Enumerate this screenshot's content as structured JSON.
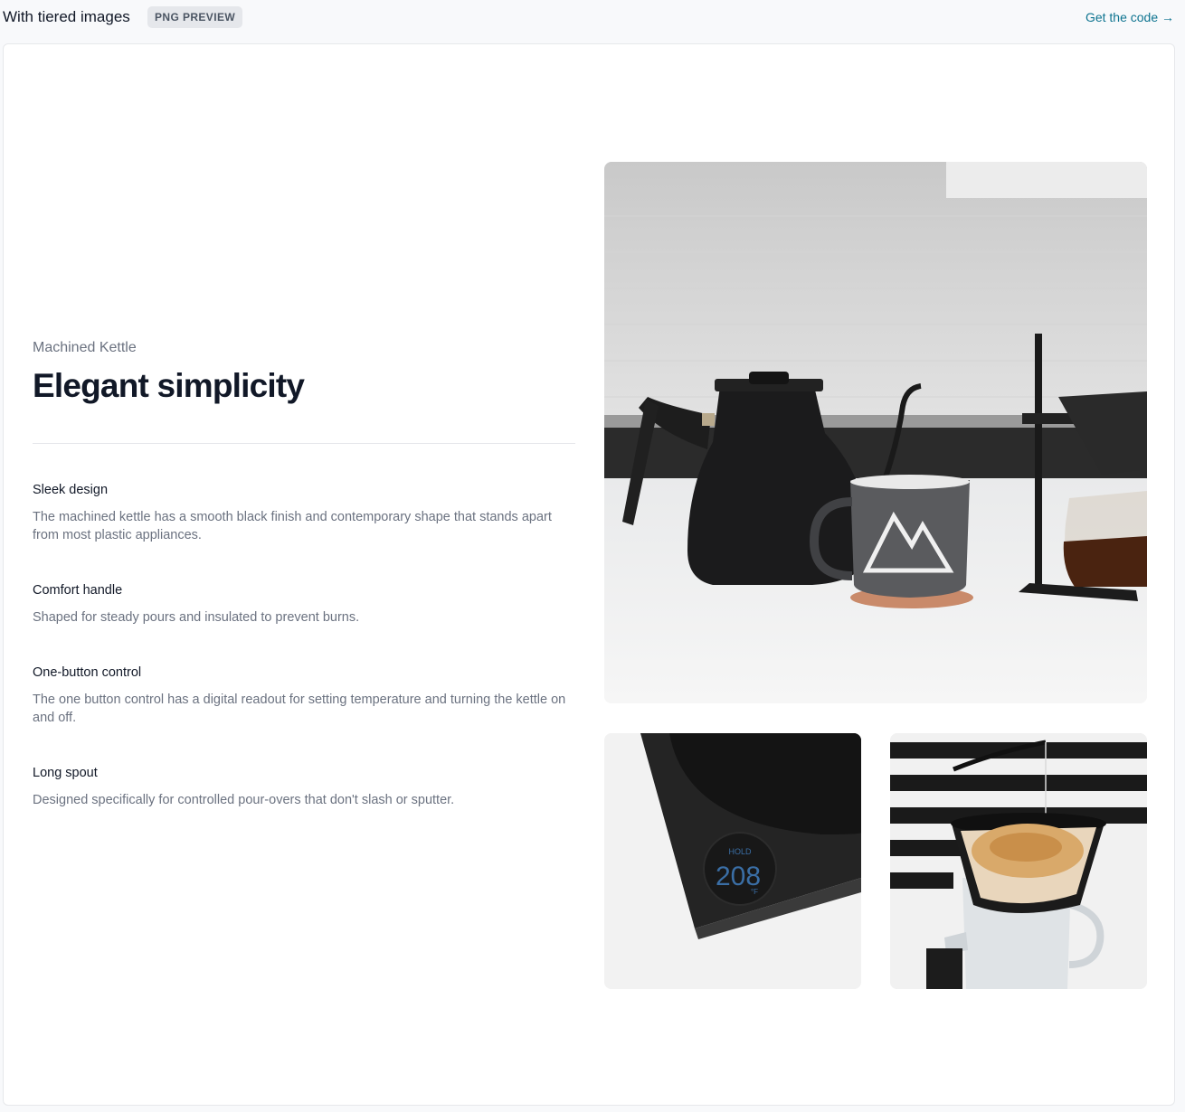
{
  "topbar": {
    "title": "With tiered images",
    "badge": "PNG PREVIEW",
    "code_link": "Get the code →"
  },
  "product": {
    "eyebrow": "Machined Kettle",
    "headline": "Elegant simplicity"
  },
  "features": [
    {
      "title": "Sleek design",
      "description": "The machined kettle has a smooth black finish and contemporary shape that stands apart from most plastic appliances."
    },
    {
      "title": "Comfort handle",
      "description": "Shaped for steady pours and insulated to prevent burns."
    },
    {
      "title": "One-button control",
      "description": "The one button control has a digital readout for setting temperature and turning the kettle on and off."
    },
    {
      "title": "Long spout",
      "description": "Designed specifically for controlled pour-overs that don't slash or sputter."
    }
  ],
  "images": {
    "main": "kettle-mug-pour-over-photo",
    "detail_left": "kettle-base-display-photo",
    "detail_right": "pour-over-brewing-photo"
  },
  "display_readout": {
    "label": "HOLD",
    "value": "208",
    "unit": "°F"
  }
}
